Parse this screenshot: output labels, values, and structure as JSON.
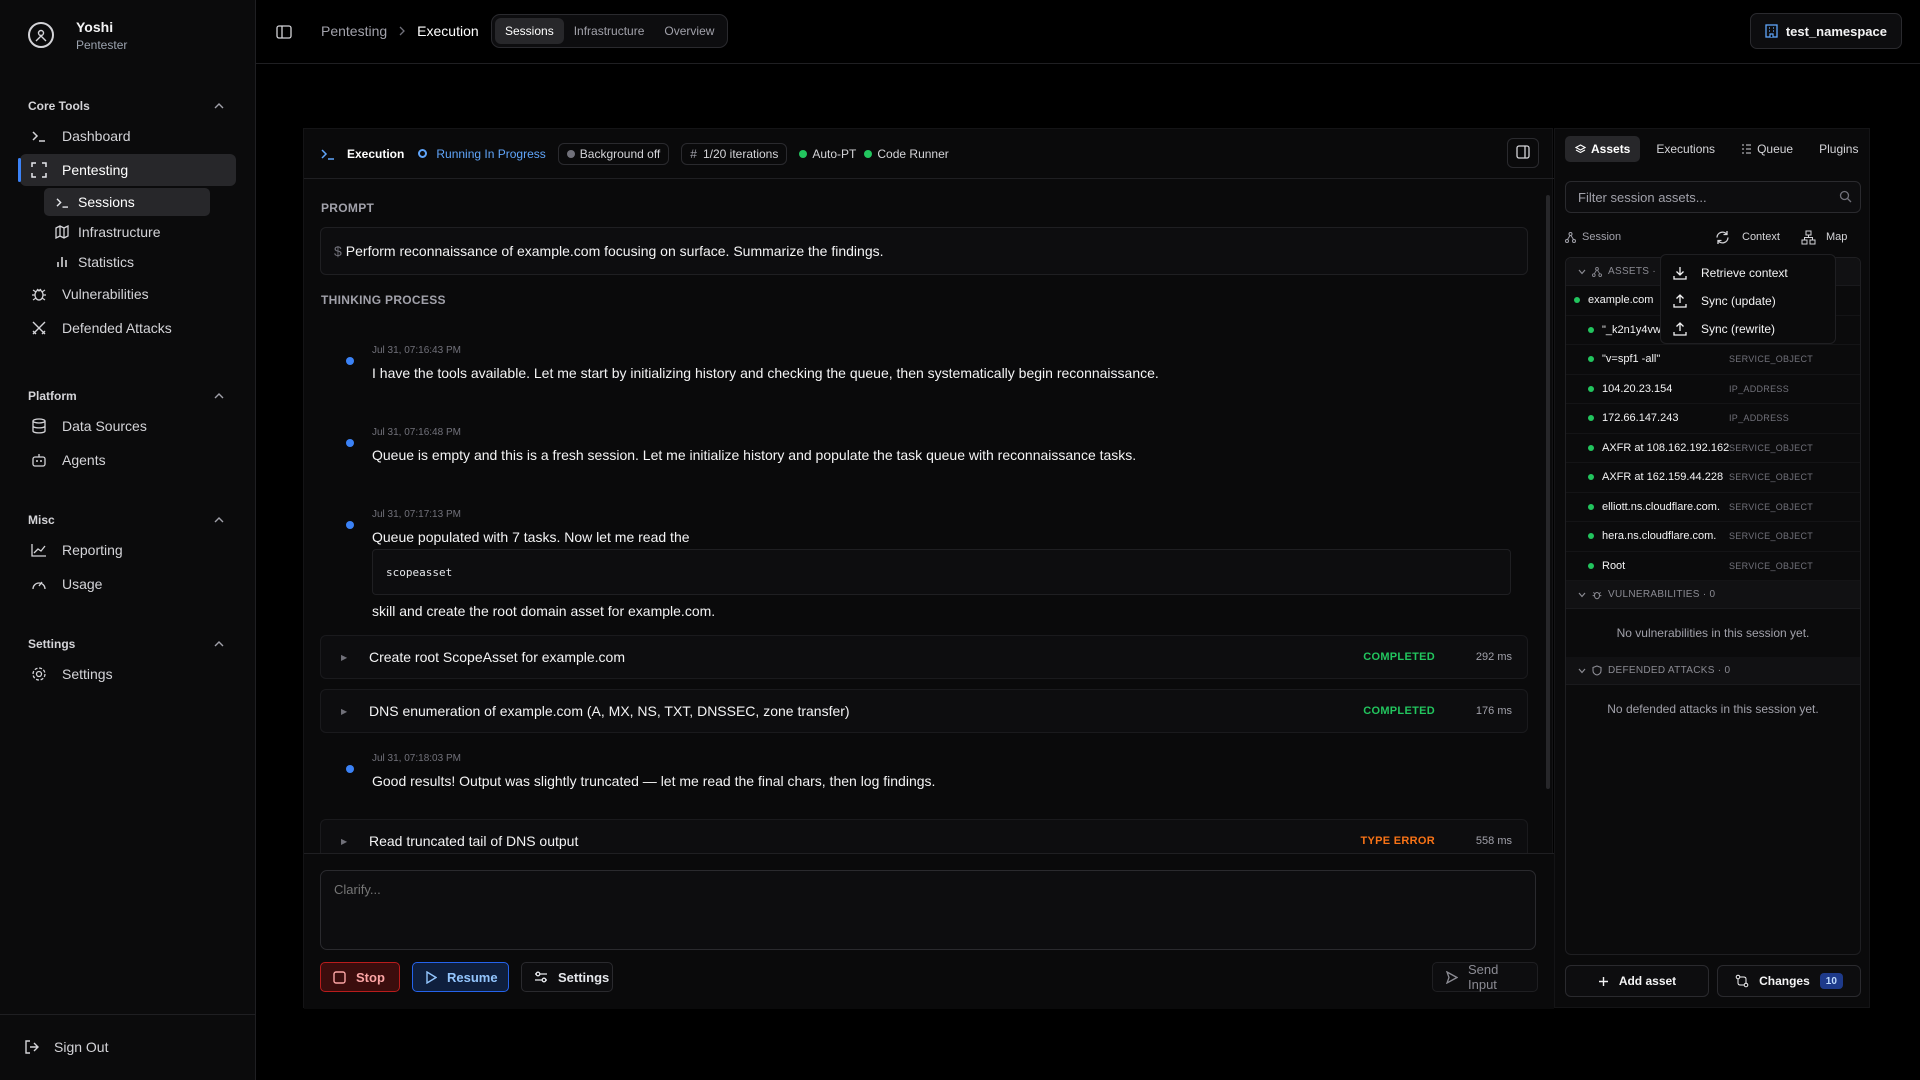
{
  "user": {
    "name": "Yoshi",
    "role": "Pentester"
  },
  "sidebar": {
    "core_tools": {
      "title": "Core Tools",
      "dashboard": "Dashboard",
      "pentesting": "Pentesting",
      "sessions": "Sessions",
      "infrastructure": "Infrastructure",
      "statistics": "Statistics",
      "vulnerabilities": "Vulnerabilities",
      "defended": "Defended Attacks"
    },
    "platform": {
      "title": "Platform",
      "data_sources": "Data Sources",
      "agents": "Agents"
    },
    "misc": {
      "title": "Misc",
      "reporting": "Reporting",
      "usage": "Usage"
    },
    "settings": {
      "title": "Settings",
      "settings": "Settings"
    },
    "signout": "Sign Out"
  },
  "topbar": {
    "crumb1": "Pentesting",
    "crumb2": "Execution",
    "tabs": [
      "Sessions",
      "Infrastructure",
      "Overview"
    ],
    "namespace": "test_namespace"
  },
  "execution": {
    "title": "Execution",
    "status": "Running In Progress",
    "background": "Background off",
    "iterations": "1/20 iterations",
    "auto_pt": "Auto-PT",
    "code_runner": "Code Runner",
    "prompt_label": "PROMPT",
    "prompt_dollar": "$",
    "prompt": "Perform reconnaissance of example.com focusing on surface. Summarize the findings.",
    "thinking_label": "THINKING PROCESS",
    "thoughts": [
      {
        "ts": "Jul 31, 07:16:43 PM",
        "text": "I have the tools available. Let me start by initializing history and checking the queue, then systematically begin reconnaissance."
      },
      {
        "ts": "Jul 31, 07:16:48 PM",
        "text": "Queue is empty and this is a fresh session. Let me initialize history and populate the task queue with reconnaissance tasks."
      },
      {
        "ts": "Jul 31, 07:17:13 PM",
        "text": "Queue populated with 7 tasks. Now let me read the",
        "code": "scopeasset",
        "text2": "skill and create the root domain asset for example.com."
      },
      {
        "ts": "Jul 31, 07:18:03 PM",
        "text": "Good results! Output was slightly truncated — let me read the final chars, then log findings."
      }
    ],
    "tasks": [
      {
        "name": "Create root ScopeAsset for example.com",
        "status": "COMPLETED",
        "ms": "292 ms"
      },
      {
        "name": "DNS enumeration of example.com (A, MX, NS, TXT, DNSSEC, zone transfer)",
        "status": "COMPLETED",
        "ms": "176 ms"
      },
      {
        "name": "Read truncated tail of DNS output",
        "status": "TYPE ERROR",
        "ms": "558 ms"
      }
    ],
    "clarify_placeholder": "Clarify...",
    "stop": "Stop",
    "resume": "Resume",
    "settings": "Settings",
    "send": "Send Input"
  },
  "assets": {
    "tabs": [
      "Assets",
      "Executions",
      "Queue",
      "Plugins"
    ],
    "filter_placeholder": "Filter session assets...",
    "session": "Session",
    "context": "Context",
    "map": "Map",
    "group_assets": "ASSETS ·",
    "items": [
      {
        "name": "example.com",
        "kind": ""
      },
      {
        "name": "\"_k2n1y4vw",
        "kind": ""
      },
      {
        "name": "\"v=spf1 -all\"",
        "kind": "SERVICE_OBJECT"
      },
      {
        "name": "104.20.23.154",
        "kind": "IP_ADDRESS"
      },
      {
        "name": "172.66.147.243",
        "kind": "IP_ADDRESS"
      },
      {
        "name": "AXFR at 108.162.192.162",
        "kind": "SERVICE_OBJECT"
      },
      {
        "name": "AXFR at 162.159.44.228",
        "kind": "SERVICE_OBJECT"
      },
      {
        "name": "elliott.ns.cloudflare.com.",
        "kind": "SERVICE_OBJECT"
      },
      {
        "name": "hera.ns.cloudflare.com.",
        "kind": "SERVICE_OBJECT"
      },
      {
        "name": "Root",
        "kind": "SERVICE_OBJECT"
      }
    ],
    "vuln_head": "VULNERABILITIES · 0",
    "vuln_empty": "No vulnerabilities in this session yet.",
    "def_head": "DEFENDED ATTACKS · 0",
    "def_empty": "No defended attacks in this session yet.",
    "add_asset": "Add asset",
    "changes": "Changes",
    "changes_count": "10"
  },
  "context_menu": {
    "retrieve": "Retrieve context",
    "sync_update": "Sync (update)",
    "sync_rewrite": "Sync (rewrite)"
  }
}
